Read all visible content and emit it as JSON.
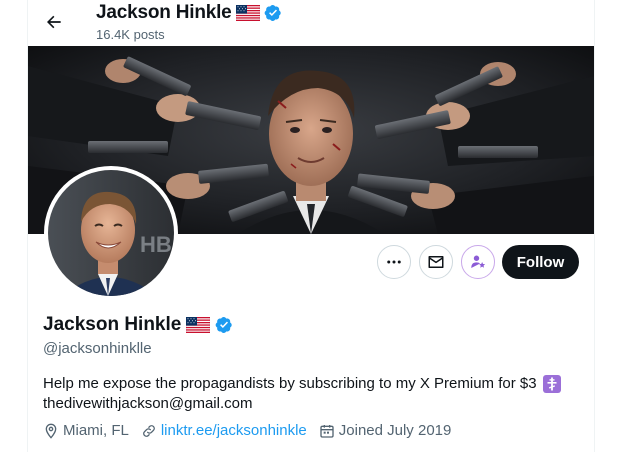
{
  "header": {
    "name": "Jackson Hinkle",
    "posts_count": "16.4K posts",
    "flag_icon": "us-flag-icon",
    "verified_icon": "verified-badge-icon",
    "back_icon": "arrow-left-icon"
  },
  "profile": {
    "name": "Jackson Hinkle",
    "handle": "@jacksonhinklle",
    "bio_line1": "Help me expose the propagandists by subscribing to my X Premium for $3",
    "bio_line2": "thedivewithjackson@gmail.com",
    "location": "Miami, FL",
    "link": "linktr.ee/jacksonhinkle",
    "joined": "Joined July 2019"
  },
  "actions": {
    "more_icon": "more-dots-icon",
    "message_icon": "mail-icon",
    "subscribe_icon": "subscribe-star-icon",
    "follow_label": "Follow"
  },
  "colors": {
    "accent": "#1d9bf0",
    "text": "#0f1419",
    "muted": "#536471",
    "follow_bg": "#0f1419",
    "premium_purple": "#8c5cd6"
  }
}
